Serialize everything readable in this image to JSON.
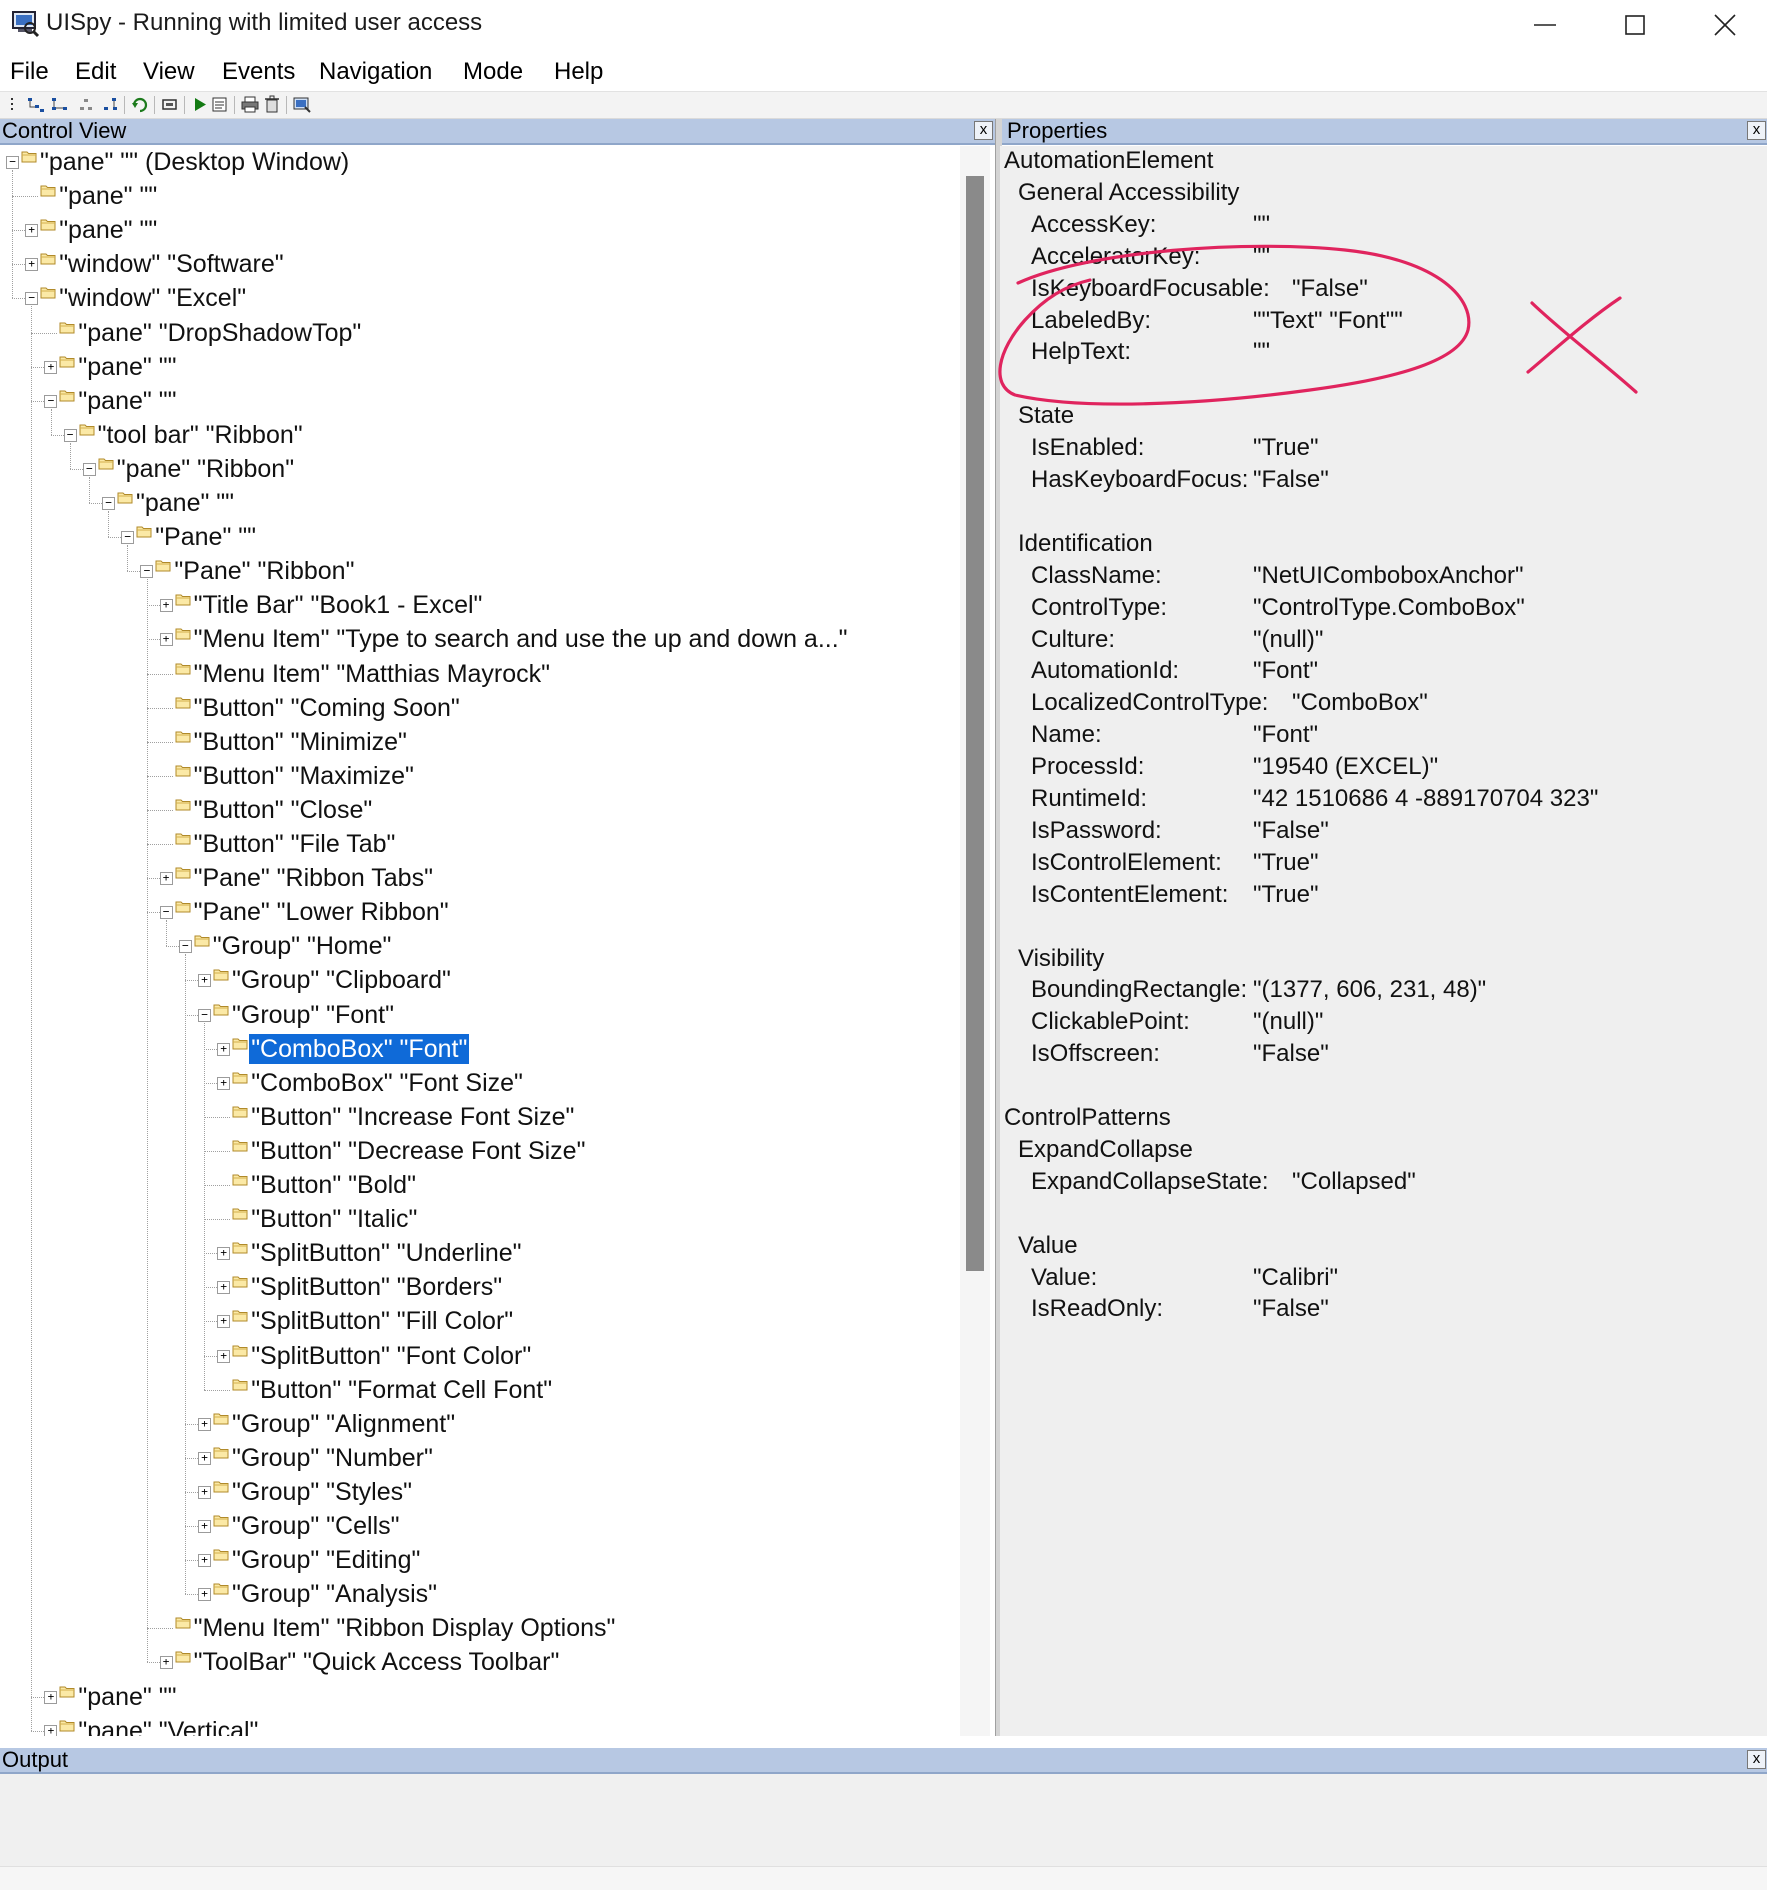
{
  "window": {
    "title": "UISpy - Running with limited user access",
    "icon": "uispy-app-icon",
    "controls": {
      "minimize": "minimize-icon",
      "maximize": "maximize-icon",
      "close": "close-icon"
    }
  },
  "menubar": [
    "File",
    "Edit",
    "View",
    "Events",
    "Navigation",
    "Mode",
    "Help"
  ],
  "toolbar": {
    "icons": [
      "tree-grip-icon",
      "tree-nav-icon-1",
      "tree-nav-icon-2",
      "tree-nav-icon-3",
      "tree-nav-icon-4",
      "refresh-icon",
      "highlight-icon",
      "play-icon",
      "properties-icon",
      "print-icon",
      "delete-icon",
      "screenshot-icon"
    ]
  },
  "control_view": {
    "title": "Control View",
    "close": "x",
    "tree": [
      {
        "label": "\"pane\" \"\" (Desktop Window)",
        "depth": 0,
        "exp": "-"
      },
      {
        "label": "\"pane\" \"\"",
        "depth": 1,
        "exp": ""
      },
      {
        "label": "\"pane\" \"\"",
        "depth": 1,
        "exp": "+"
      },
      {
        "label": "\"window\" \"Software\"",
        "depth": 1,
        "exp": "+"
      },
      {
        "label": "\"window\" \"Excel\"",
        "depth": 1,
        "exp": "-"
      },
      {
        "label": "\"pane\" \"DropShadowTop\"",
        "depth": 2,
        "exp": ""
      },
      {
        "label": "\"pane\" \"\"",
        "depth": 2,
        "exp": "+"
      },
      {
        "label": "\"pane\" \"\"",
        "depth": 2,
        "exp": "-"
      },
      {
        "label": "\"tool bar\" \"Ribbon\"",
        "depth": 3,
        "exp": "-"
      },
      {
        "label": "\"pane\" \"Ribbon\"",
        "depth": 4,
        "exp": "-"
      },
      {
        "label": "\"pane\" \"\"",
        "depth": 5,
        "exp": "-"
      },
      {
        "label": "\"Pane\" \"\"",
        "depth": 6,
        "exp": "-"
      },
      {
        "label": "\"Pane\" \"Ribbon\"",
        "depth": 7,
        "exp": "-"
      },
      {
        "label": "\"Title Bar\" \"Book1  -  Excel\"",
        "depth": 8,
        "exp": "+"
      },
      {
        "label": "\"Menu Item\" \"Type to search and use the up and down a...\"",
        "depth": 8,
        "exp": "+"
      },
      {
        "label": "\"Menu Item\" \"Matthias Mayrock\"",
        "depth": 8,
        "exp": ""
      },
      {
        "label": "\"Button\" \"Coming Soon\"",
        "depth": 8,
        "exp": ""
      },
      {
        "label": "\"Button\" \"Minimize\"",
        "depth": 8,
        "exp": ""
      },
      {
        "label": "\"Button\" \"Maximize\"",
        "depth": 8,
        "exp": ""
      },
      {
        "label": "\"Button\" \"Close\"",
        "depth": 8,
        "exp": ""
      },
      {
        "label": "\"Button\" \"File Tab\"",
        "depth": 8,
        "exp": ""
      },
      {
        "label": "\"Pane\" \"Ribbon Tabs\"",
        "depth": 8,
        "exp": "+"
      },
      {
        "label": "\"Pane\" \"Lower Ribbon\"",
        "depth": 8,
        "exp": "-"
      },
      {
        "label": "\"Group\" \"Home\"",
        "depth": 9,
        "exp": "-"
      },
      {
        "label": "\"Group\" \"Clipboard\"",
        "depth": 10,
        "exp": "+"
      },
      {
        "label": "\"Group\" \"Font\"",
        "depth": 10,
        "exp": "-"
      },
      {
        "label": "\"ComboBox\" \"Font\"",
        "depth": 11,
        "exp": "+",
        "selected": true
      },
      {
        "label": "\"ComboBox\" \"Font Size\"",
        "depth": 11,
        "exp": "+"
      },
      {
        "label": "\"Button\" \"Increase Font Size\"",
        "depth": 11,
        "exp": ""
      },
      {
        "label": "\"Button\" \"Decrease Font Size\"",
        "depth": 11,
        "exp": ""
      },
      {
        "label": "\"Button\" \"Bold\"",
        "depth": 11,
        "exp": ""
      },
      {
        "label": "\"Button\" \"Italic\"",
        "depth": 11,
        "exp": ""
      },
      {
        "label": "\"SplitButton\" \"Underline\"",
        "depth": 11,
        "exp": "+"
      },
      {
        "label": "\"SplitButton\" \"Borders\"",
        "depth": 11,
        "exp": "+"
      },
      {
        "label": "\"SplitButton\" \"Fill Color\"",
        "depth": 11,
        "exp": "+"
      },
      {
        "label": "\"SplitButton\" \"Font Color\"",
        "depth": 11,
        "exp": "+"
      },
      {
        "label": "\"Button\" \"Format Cell Font\"",
        "depth": 11,
        "exp": ""
      },
      {
        "label": "\"Group\" \"Alignment\"",
        "depth": 10,
        "exp": "+"
      },
      {
        "label": "\"Group\" \"Number\"",
        "depth": 10,
        "exp": "+"
      },
      {
        "label": "\"Group\" \"Styles\"",
        "depth": 10,
        "exp": "+"
      },
      {
        "label": "\"Group\" \"Cells\"",
        "depth": 10,
        "exp": "+"
      },
      {
        "label": "\"Group\" \"Editing\"",
        "depth": 10,
        "exp": "+"
      },
      {
        "label": "\"Group\" \"Analysis\"",
        "depth": 10,
        "exp": "+"
      },
      {
        "label": "\"Menu Item\" \"Ribbon Display Options\"",
        "depth": 8,
        "exp": ""
      },
      {
        "label": "\"ToolBar\" \"Quick Access Toolbar\"",
        "depth": 8,
        "exp": "+"
      },
      {
        "label": "\"pane\" \"\"",
        "depth": 2,
        "exp": "+"
      },
      {
        "label": "\"pane\" \"Vertical\"",
        "depth": 2,
        "exp": "+"
      }
    ]
  },
  "properties": {
    "title": "Properties",
    "close": "x",
    "lines": [
      {
        "type": "section",
        "text": "AutomationElement",
        "indent": 0
      },
      {
        "type": "group",
        "text": "General Accessibility",
        "indent": 1
      },
      {
        "type": "prop",
        "key": "AccessKey:",
        "value": "\"\"",
        "indent": 2
      },
      {
        "type": "prop",
        "key": "AcceleratorKey:",
        "value": "\"\"",
        "indent": 2
      },
      {
        "type": "prop",
        "key": "IsKeyboardFocusable:",
        "value": "\"False\"",
        "indent": 2,
        "wide": true
      },
      {
        "type": "prop",
        "key": "LabeledBy:",
        "value": "\"\"Text\" \"Font\"\"",
        "indent": 2
      },
      {
        "type": "prop",
        "key": "HelpText:",
        "value": "\"\"",
        "indent": 2
      },
      {
        "type": "blank"
      },
      {
        "type": "group",
        "text": "State",
        "indent": 1
      },
      {
        "type": "prop",
        "key": "IsEnabled:",
        "value": "\"True\"",
        "indent": 2
      },
      {
        "type": "prop",
        "key": "HasKeyboardFocus:",
        "value": "\"False\"",
        "indent": 2
      },
      {
        "type": "blank"
      },
      {
        "type": "group",
        "text": "Identification",
        "indent": 1
      },
      {
        "type": "prop",
        "key": "ClassName:",
        "value": "\"NetUIComboboxAnchor\"",
        "indent": 2
      },
      {
        "type": "prop",
        "key": "ControlType:",
        "value": "\"ControlType.ComboBox\"",
        "indent": 2
      },
      {
        "type": "prop",
        "key": "Culture:",
        "value": "\"(null)\"",
        "indent": 2
      },
      {
        "type": "prop",
        "key": "AutomationId:",
        "value": "\"Font\"",
        "indent": 2
      },
      {
        "type": "prop",
        "key": "LocalizedControlType:",
        "value": "\"ComboBox\"",
        "indent": 2,
        "wide": true
      },
      {
        "type": "prop",
        "key": "Name:",
        "value": "\"Font\"",
        "indent": 2
      },
      {
        "type": "prop",
        "key": "ProcessId:",
        "value": "\"19540 (EXCEL)\"",
        "indent": 2
      },
      {
        "type": "prop",
        "key": "RuntimeId:",
        "value": "\"42 1510686 4 -889170704 323\"",
        "indent": 2
      },
      {
        "type": "prop",
        "key": "IsPassword:",
        "value": "\"False\"",
        "indent": 2
      },
      {
        "type": "prop",
        "key": "IsControlElement:",
        "value": "\"True\"",
        "indent": 2
      },
      {
        "type": "prop",
        "key": "IsContentElement:",
        "value": "\"True\"",
        "indent": 2
      },
      {
        "type": "blank"
      },
      {
        "type": "group",
        "text": "Visibility",
        "indent": 1
      },
      {
        "type": "prop",
        "key": "BoundingRectangle:",
        "value": "\"(1377, 606, 231, 48)\"",
        "indent": 2
      },
      {
        "type": "prop",
        "key": "ClickablePoint:",
        "value": "\"(null)\"",
        "indent": 2
      },
      {
        "type": "prop",
        "key": "IsOffscreen:",
        "value": "\"False\"",
        "indent": 2
      },
      {
        "type": "blank"
      },
      {
        "type": "section",
        "text": "ControlPatterns",
        "indent": 0
      },
      {
        "type": "group",
        "text": "ExpandCollapse",
        "indent": 1
      },
      {
        "type": "prop",
        "key": "ExpandCollapseState:",
        "value": "\"Collapsed\"",
        "indent": 2,
        "wide": true
      },
      {
        "type": "blank"
      },
      {
        "type": "group",
        "text": "Value",
        "indent": 1
      },
      {
        "type": "prop",
        "key": "Value:",
        "value": "\"Calibri\"",
        "indent": 2
      },
      {
        "type": "prop",
        "key": "IsReadOnly:",
        "value": "\"False\"",
        "indent": 2
      }
    ]
  },
  "output": {
    "title": "Output",
    "close": "x",
    "text": ""
  },
  "annotation": {
    "color": "#e0245e",
    "marks": [
      "circle-around-properties",
      "cross-mark"
    ]
  }
}
